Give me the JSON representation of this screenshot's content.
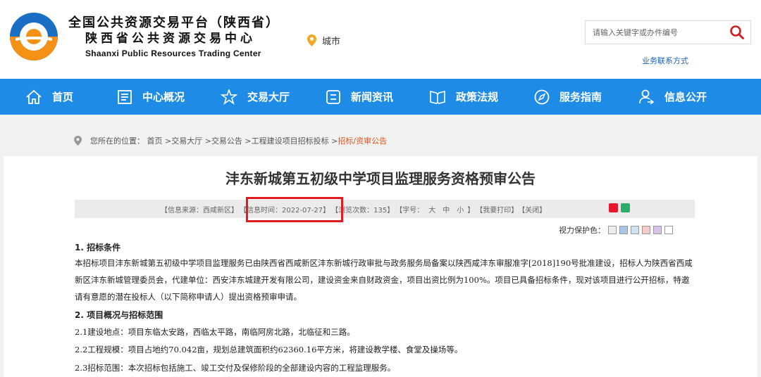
{
  "header": {
    "brand_cn_line1": "全国公共资源交易平台（陕西省）",
    "brand_cn_line2": "陕西省公共资源交易中心",
    "brand_en": "Shaanxi Public Resources Trading Center",
    "city_label": "城市",
    "search_placeholder": "请输入关键字或办件编号",
    "business_contact": "业务联系方式"
  },
  "nav": {
    "items": [
      {
        "label": "首页",
        "icon": "home-icon"
      },
      {
        "label": "中心概况",
        "icon": "document-icon"
      },
      {
        "label": "交易大厅",
        "icon": "star-icon"
      },
      {
        "label": "新闻资讯",
        "icon": "news-icon"
      },
      {
        "label": "政策法规",
        "icon": "book-icon"
      },
      {
        "label": "服务指南",
        "icon": "compass-icon"
      },
      {
        "label": "信息公开",
        "icon": "user-icon"
      }
    ]
  },
  "breadcrumb": {
    "prefix": "您所在的位置：",
    "items": [
      "首页",
      "交易大厅",
      "交易公告",
      "工程建设项目招标投标"
    ],
    "current": "招标/资审公告"
  },
  "article": {
    "title": "沣东新城第五初级中学项目监理服务资格预审公告",
    "meta": {
      "source": "【信息来源：西咸新区】",
      "time": "【信息时间：2022-07-27】",
      "views": "【浏览次数：135】",
      "fontsize_label": "【字号：",
      "fs_large": "大",
      "fs_medium": "中",
      "fs_small": "小",
      "fontsize_end": "】",
      "print": "【我要打印】",
      "close": "【关闭】"
    },
    "eye_protect_label": "视力保护色：",
    "section1_heading": "1. 招标条件",
    "section1_body": "本招标项目沣东新城第五初级中学项目监理服务已由陕西省西咸新区沣东新城行政审批与政务服务局备案以陕西咸沣东审服准字[2018]190号批准建设，招标人为陕西省西咸新区沣东新城管理委员会，代建单位：西安沣东城建开发有限公司，建设资金来自财政资金，项目出资比例为100%。项目已具备招标条件，现对该项目进行公开招标，特邀请有意愿的潜在投标人（以下简称申请人）提出资格预审申请。",
    "section2_heading": "2. 项目概况与招标范围",
    "section2_items": [
      "2.1建设地点：项目东临太安路，西临太平路，南临阿房北路，北临征和三路。",
      "2.2工程规模：项目占地约70.042亩，规划总建筑面积约62360.16平方米，将建设教学楼、食堂及操场等。",
      "2.3招标范围：本次招标包括施工、竣工交付及保修阶段的全部建设内容的工程监理服务。"
    ]
  },
  "colors": {
    "nav_blue": "#1e8be6",
    "logo_orange": "#f39215",
    "logo_blue": "#1a6fc4",
    "highlight_red": "#e11b22",
    "current_orange": "#e8531a",
    "eye_swatches": [
      "#eeeeee",
      "#a9c6e8",
      "#cfe2f3",
      "#f4cccc",
      "#d9c2e9",
      "#ffffff"
    ]
  }
}
